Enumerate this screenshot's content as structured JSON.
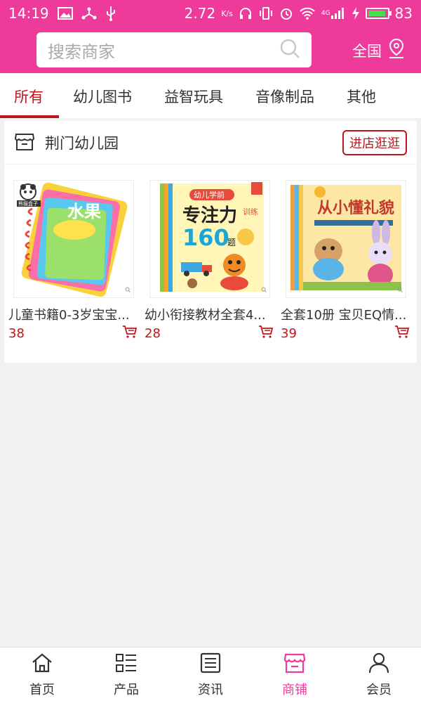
{
  "status_bar": {
    "time": "14:19",
    "net_speed": "2.72",
    "net_unit": "K/s",
    "battery": "83",
    "signal": "4G"
  },
  "search": {
    "placeholder": "搜索商家"
  },
  "region": {
    "label": "全国"
  },
  "tabs": [
    {
      "label": "所有",
      "active": true
    },
    {
      "label": "幼儿图书",
      "active": false
    },
    {
      "label": "益智玩具",
      "active": false
    },
    {
      "label": "音像制品",
      "active": false
    },
    {
      "label": "其他",
      "active": false
    }
  ],
  "store": {
    "name": "荆门幼儿园",
    "enter_label": "进店逛逛",
    "products": [
      {
        "title": "儿童书籍0-3岁宝宝...",
        "price": "38"
      },
      {
        "title": "幼小衔接教材全套4...",
        "price": "28"
      },
      {
        "title": "全套10册 宝贝EQ情...",
        "price": "39"
      }
    ]
  },
  "book_art": {
    "book1": {
      "panda_label": "熊猫盒子",
      "cover_text": "水果"
    },
    "book2": {
      "ribbon": "幼儿学前",
      "title": "专注力",
      "side": "训练",
      "number": "160",
      "suffix": "题"
    },
    "book3": {
      "title": "从小懂礼貌"
    }
  },
  "bottom_nav": [
    {
      "label": "首页",
      "icon": "home-icon",
      "active": false
    },
    {
      "label": "产品",
      "icon": "list-icon",
      "active": false
    },
    {
      "label": "资讯",
      "icon": "news-icon",
      "active": false
    },
    {
      "label": "商铺",
      "icon": "store-icon",
      "active": true
    },
    {
      "label": "会员",
      "icon": "user-icon",
      "active": false
    }
  ],
  "colors": {
    "brand": "#ee3a9a",
    "accent_red": "#c0151b",
    "background": "#f1f1f1"
  }
}
